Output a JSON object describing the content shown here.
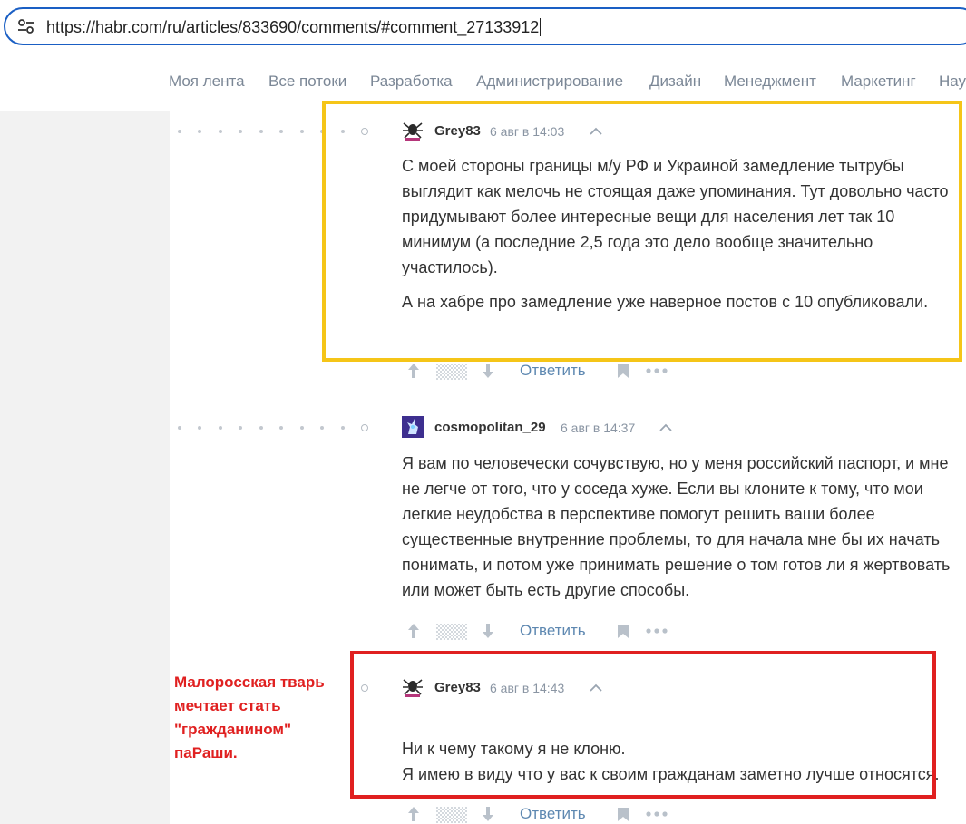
{
  "browser": {
    "url": "https://habr.com/ru/articles/833690/comments/#comment_27133912",
    "site_info_icon": "tune-icon"
  },
  "nav": {
    "items": [
      "Моя лента",
      "Все потоки",
      "Разработка",
      "Администрирование",
      "Дизайн",
      "Менеджмент",
      "Маркетинг",
      "Нау"
    ]
  },
  "comments": [
    {
      "user": "Grey83",
      "date": "6 авг в 14:03",
      "avatar_icon": "spider-avatar-icon",
      "paragraphs": [
        "С моей стороны границы м/у РФ и Украиной замедление тытрубы выглядит как мелочь не стоящая даже упоминания. Тут довольно часто придумывают более интересные вещи для населения лет так 10 минимум (а последние 2,5 года это дело вообще значительно участилось).",
        "А на хабре про замедление уже наверное постов с 10 опубликовали."
      ],
      "reply": "Ответить"
    },
    {
      "user": "cosmopolitan_29",
      "date": "6 авг в 14:37",
      "avatar_icon": "unicorn-avatar-icon",
      "paragraphs": [
        "Я вам по человечески сочувствую, но у меня российский паспорт, и мне не легче от того, что у соседа хуже. Если вы клоните к тому, что мои легкие неудобства в перспективе помогут решить ваши более существенные внутренние проблемы, то для начала мне бы их начать понимать, и потом уже принимать решение о том готов ли я жертвовать или может быть есть другие способы."
      ],
      "reply": "Ответить"
    },
    {
      "user": "Grey83",
      "date": "6 авг в 14:43",
      "avatar_icon": "spider-avatar-icon",
      "paragraphs": [
        "Ни к чему такому я не клоню.\nЯ имею в виду что у вас к своим гражданам заметно лучше относятся."
      ],
      "reply": "Ответить"
    }
  ],
  "annotation": {
    "text": "Малоросская тварь\nмечтает стать\n\"гражданином\"\nпаРаши.",
    "color": "#e02020"
  },
  "colors": {
    "highlight_yellow": "#f5c518",
    "highlight_red": "#e02020",
    "link": "#5e88b1",
    "meta": "#8a95a3"
  }
}
